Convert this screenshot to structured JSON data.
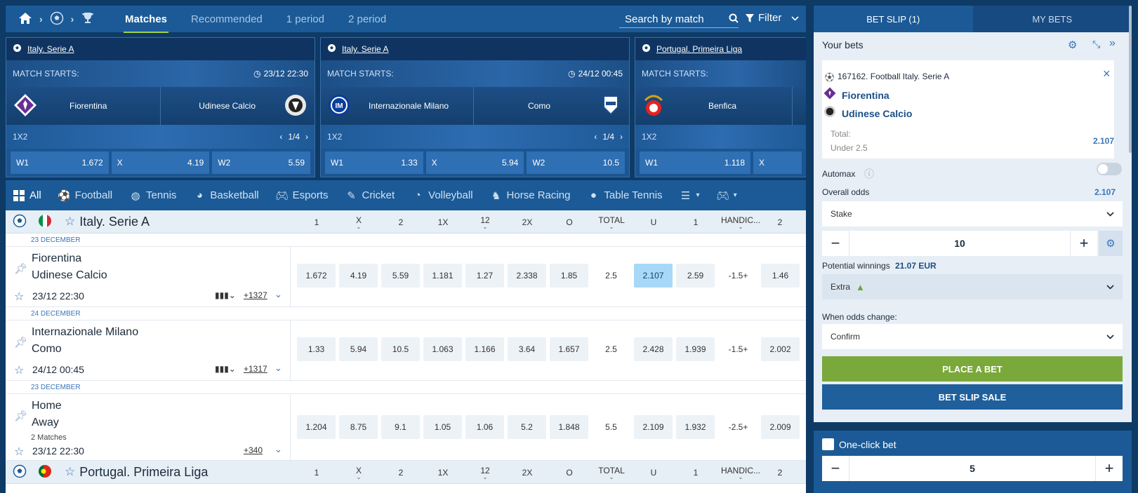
{
  "nav": {
    "tabs": [
      "Matches",
      "Recommended",
      "1 period",
      "2 period"
    ],
    "search_placeholder": "Search by match",
    "filter_label": "Filter"
  },
  "cards": [
    {
      "league": "Italy. Serie A",
      "starts_label": "MATCH STARTS:",
      "time": "23/12 22:30",
      "team1": "Fiorentina",
      "team2": "Udinese Calcio",
      "market": "1X2",
      "pager": "1/4",
      "odds": [
        {
          "label": "W1",
          "value": "1.672"
        },
        {
          "label": "X",
          "value": "4.19"
        },
        {
          "label": "W2",
          "value": "5.59"
        }
      ]
    },
    {
      "league": "Italy. Serie A",
      "starts_label": "MATCH STARTS:",
      "time": "24/12 00:45",
      "team1": "Internazionale Milano",
      "team2": "Como",
      "market": "1X2",
      "pager": "1/4",
      "odds": [
        {
          "label": "W1",
          "value": "1.33"
        },
        {
          "label": "X",
          "value": "5.94"
        },
        {
          "label": "W2",
          "value": "10.5"
        }
      ]
    },
    {
      "league": "Portugal. Primeira Liga",
      "starts_label": "MATCH STARTS:",
      "time": "",
      "team1": "Benfica",
      "team2": "",
      "market": "1X2",
      "pager": "",
      "odds": [
        {
          "label": "W1",
          "value": "1.118"
        },
        {
          "label": "X",
          "value": ""
        }
      ]
    }
  ],
  "sports": [
    "All",
    "Football",
    "Tennis",
    "Basketball",
    "Esports",
    "Cricket",
    "Volleyball",
    "Horse Racing",
    "Table Tennis"
  ],
  "columns": [
    "1",
    "X",
    "2",
    "1X",
    "12",
    "2X",
    "O",
    "TOTAL",
    "U",
    "1",
    "HANDIC...",
    "2"
  ],
  "leagues": {
    "serie_a": "Italy. Serie A",
    "primeira": "Portugal. Primeira Liga"
  },
  "matches": [
    {
      "date_band": "23 DECEMBER",
      "team1": "Fiorentina",
      "team2": "Udinese Calcio",
      "sub": "",
      "datetime": "23/12 22:30",
      "more": "+1327",
      "odds": [
        "1.672",
        "4.19",
        "5.59",
        "1.181",
        "1.27",
        "2.338",
        "1.85",
        "2.5",
        "2.107",
        "2.59",
        "-1.5+",
        "1.46"
      ]
    },
    {
      "date_band": "24 DECEMBER",
      "team1": "Internazionale Milano",
      "team2": "Como",
      "sub": "",
      "datetime": "24/12 00:45",
      "more": "+1317",
      "odds": [
        "1.33",
        "5.94",
        "10.5",
        "1.063",
        "1.166",
        "3.64",
        "1.657",
        "2.5",
        "2.428",
        "1.939",
        "-1.5+",
        "2.002"
      ]
    },
    {
      "date_band": "23 DECEMBER",
      "team1": "Home",
      "team2": "Away",
      "sub": "2 Matches",
      "datetime": "23/12 22:30",
      "more": "+340",
      "odds": [
        "1.204",
        "8.75",
        "9.1",
        "1.05",
        "1.06",
        "5.2",
        "1.848",
        "5.5",
        "2.109",
        "1.932",
        "-2.5+",
        "2.009"
      ]
    }
  ],
  "slip": {
    "tab_betslip": "BET SLIP (1)",
    "tab_mybets": "MY BETS",
    "your_bets": "Your bets",
    "bet_event": "167162. Football Italy. Serie A",
    "bet_team1": "Fiorentina",
    "bet_team2": "Udinese Calcio",
    "bet_market": "Total:",
    "bet_outcome": "Under 2.5",
    "bet_odds": "2.107",
    "automax": "Automax",
    "overall_odds_label": "Overall odds",
    "overall_odds": "2.107",
    "stake_label": "Stake",
    "stake_value": "10",
    "potential_label": "Potential winnings",
    "potential_value": "21.07 EUR",
    "extra": "Extra",
    "odds_change_label": "When odds change:",
    "odds_change_value": "Confirm",
    "place_bet": "PLACE A BET",
    "slip_sale": "BET SLIP SALE",
    "one_click": "One-click bet",
    "one_click_value": "5"
  },
  "colors": {
    "nav_bg": "#1b5a96",
    "accent_green": "#7aa83a",
    "selected_odd": "#a8d8f7",
    "sale_btn": "#1f5f9c"
  }
}
